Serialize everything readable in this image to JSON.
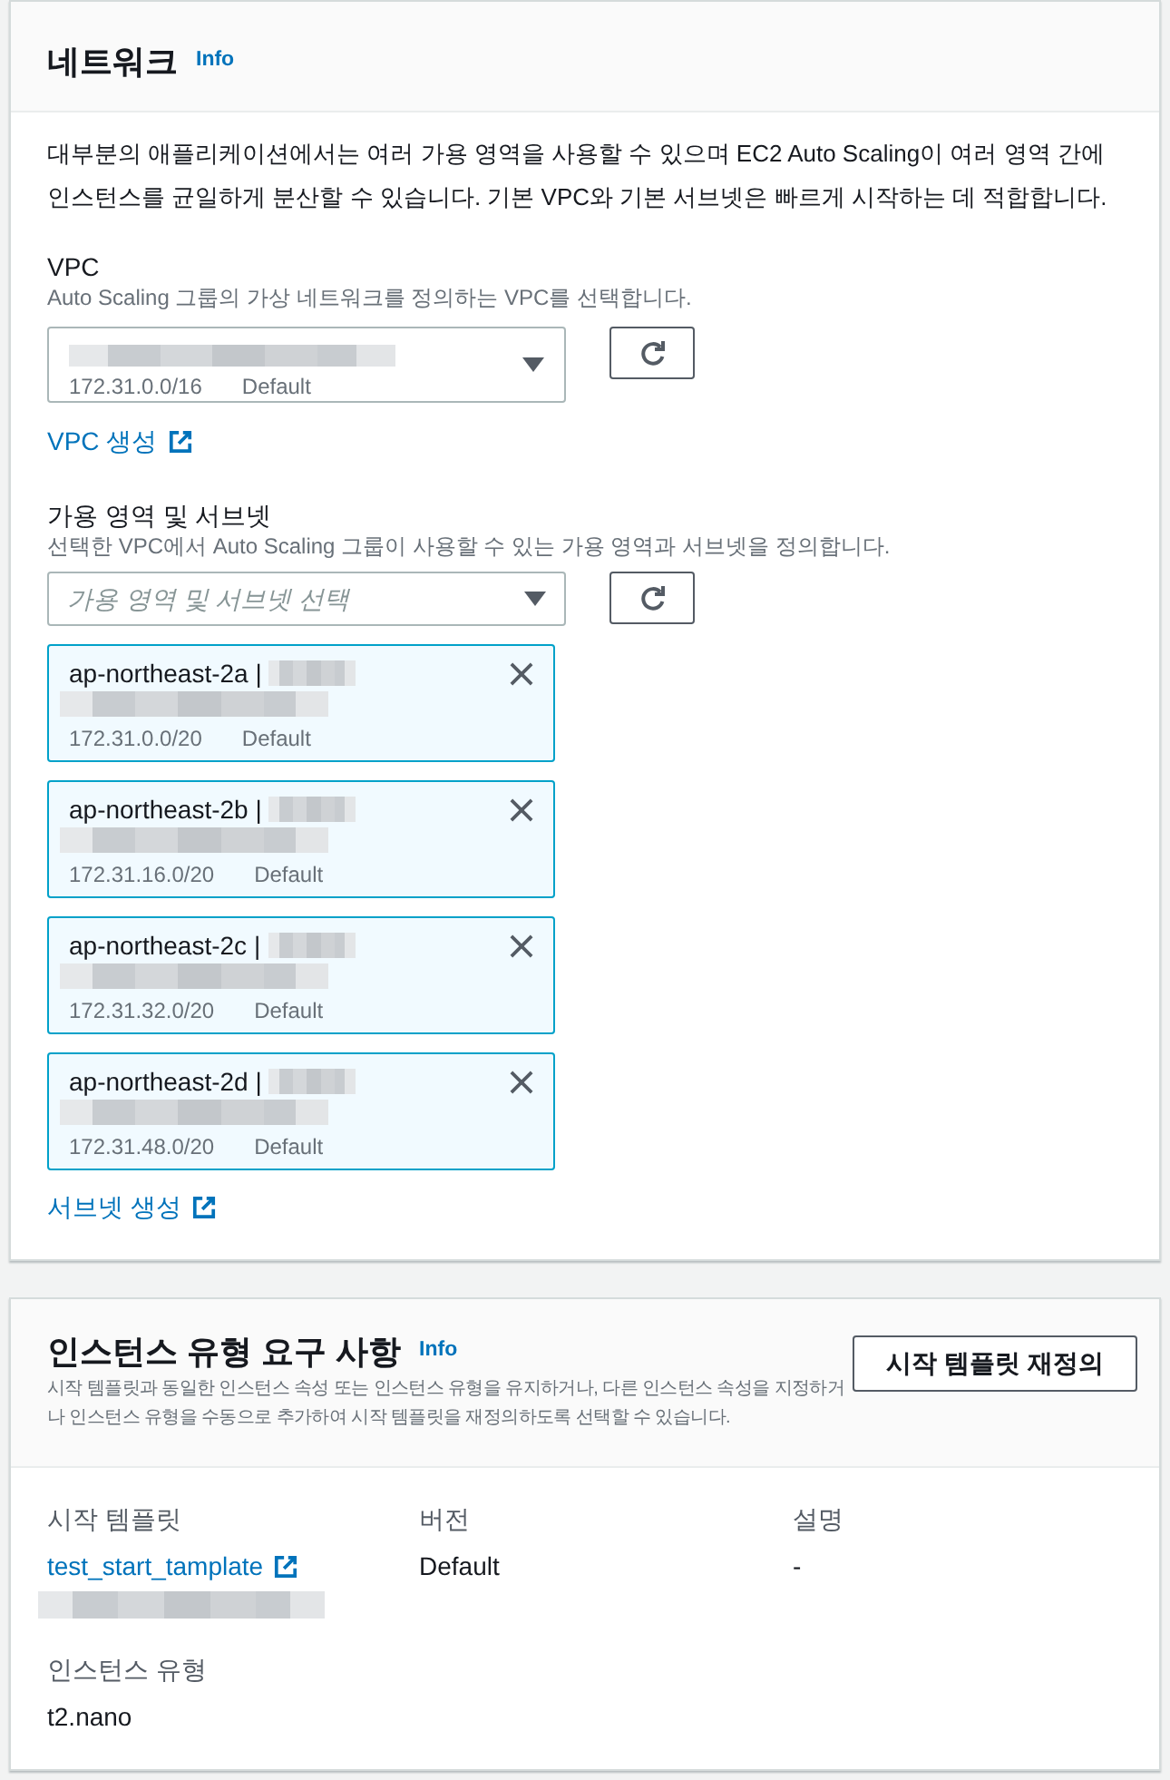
{
  "network_panel": {
    "title": "네트워크",
    "info_link": "Info",
    "description": "대부분의 애플리케이션에서는 여러 가용 영역을 사용할 수 있으며 EC2 Auto Scaling이 여러 영역 간에 인스턴스를 균일하게 분산할 수 있습니다. 기본 VPC와 기본 서브넷은 빠르게 시작하는 데 적합합니다.",
    "vpc": {
      "label": "VPC",
      "description": "Auto Scaling 그룹의 가상 네트워크를 정의하는 VPC를 선택합니다.",
      "value": {
        "blurred": true,
        "cidr": "172.31.0.0/16",
        "tag": "Default"
      }
    },
    "create_vpc_link": "VPC 생성",
    "subnets": {
      "label": "가용 영역 및 서브넷",
      "description": "선택한 VPC에서 Auto Scaling 그룹이 사용할 수 있는 가용 영역과 서브넷을 정의합니다.",
      "placeholder": "가용 영역 및 서브넷 선택",
      "tokens": [
        {
          "zone": "ap-northeast-2a |",
          "blurred": true,
          "cidr": "172.31.0.0/20",
          "tag": "Default"
        },
        {
          "zone": "ap-northeast-2b |",
          "blurred": true,
          "cidr": "172.31.16.0/20",
          "tag": "Default"
        },
        {
          "zone": "ap-northeast-2c |",
          "blurred": true,
          "cidr": "172.31.32.0/20",
          "tag": "Default"
        },
        {
          "zone": "ap-northeast-2d |",
          "blurred": true,
          "cidr": "172.31.48.0/20",
          "tag": "Default"
        }
      ]
    },
    "create_subnet_link": "서브넷 생성"
  },
  "instance_type_panel": {
    "title": "인스턴스 유형 요구 사항",
    "info_link": "Info",
    "description": "시작 템플릿과 동일한 인스턴스 속성 또는 인스턴스 유형을 유지하거나, 다른 인스턴스 속성을 지정하거나 인스턴스 유형을 수동으로 추가하여 시작 템플릿을 재정의하도록 선택할 수 있습니다.",
    "override_button": "시작 템플릿 재정의",
    "details": [
      {
        "label": "시작 템플릿",
        "value": "test_start_tamplate",
        "kind": "link",
        "blurred": true
      },
      {
        "label": "버전",
        "value": "Default",
        "kind": "text",
        "blurred": false
      },
      {
        "label": "설명",
        "value": "-",
        "kind": "text",
        "blurred": false
      }
    ],
    "instance_type": {
      "label": "인스턴스 유형",
      "value": "t2.nano"
    }
  }
}
